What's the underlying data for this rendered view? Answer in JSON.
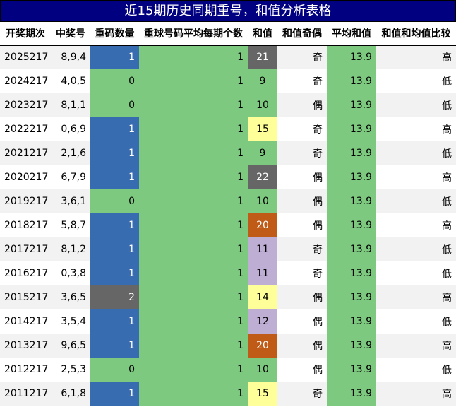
{
  "title": "近15期历史同期重号，和值分析表格",
  "headers": [
    "开奖期次",
    "中奖号",
    "重码数量",
    "重球号码平均每期个数",
    "和值",
    "和值奇偶",
    "平均和值",
    "和值和均值比较"
  ],
  "colors": {
    "title_bg": "#000080",
    "green": "#7dc97f",
    "blue": "#386cb0",
    "dark_gray": "#666666",
    "yellow": "#ffff99",
    "orange": "#bf5b17",
    "lavender": "#beaed4",
    "stripe": "#f2f2f2"
  },
  "rows": [
    {
      "period": "2025217",
      "numbers": "8,9,4",
      "repeat": "1",
      "avg_repeat": "1",
      "sum": "21",
      "parity": "奇",
      "avg_sum": "13.9",
      "compare": "高"
    },
    {
      "period": "2024217",
      "numbers": "4,0,5",
      "repeat": "0",
      "avg_repeat": "1",
      "sum": "9",
      "parity": "奇",
      "avg_sum": "13.9",
      "compare": "低"
    },
    {
      "period": "2023217",
      "numbers": "8,1,1",
      "repeat": "0",
      "avg_repeat": "1",
      "sum": "10",
      "parity": "偶",
      "avg_sum": "13.9",
      "compare": "低"
    },
    {
      "period": "2022217",
      "numbers": "0,6,9",
      "repeat": "1",
      "avg_repeat": "1",
      "sum": "15",
      "parity": "奇",
      "avg_sum": "13.9",
      "compare": "高"
    },
    {
      "period": "2021217",
      "numbers": "2,1,6",
      "repeat": "1",
      "avg_repeat": "1",
      "sum": "9",
      "parity": "奇",
      "avg_sum": "13.9",
      "compare": "低"
    },
    {
      "period": "2020217",
      "numbers": "6,7,9",
      "repeat": "1",
      "avg_repeat": "1",
      "sum": "22",
      "parity": "偶",
      "avg_sum": "13.9",
      "compare": "高"
    },
    {
      "period": "2019217",
      "numbers": "3,6,1",
      "repeat": "0",
      "avg_repeat": "1",
      "sum": "10",
      "parity": "偶",
      "avg_sum": "13.9",
      "compare": "低"
    },
    {
      "period": "2018217",
      "numbers": "5,8,7",
      "repeat": "1",
      "avg_repeat": "1",
      "sum": "20",
      "parity": "偶",
      "avg_sum": "13.9",
      "compare": "高"
    },
    {
      "period": "2017217",
      "numbers": "8,1,2",
      "repeat": "1",
      "avg_repeat": "1",
      "sum": "11",
      "parity": "奇",
      "avg_sum": "13.9",
      "compare": "低"
    },
    {
      "period": "2016217",
      "numbers": "0,3,8",
      "repeat": "1",
      "avg_repeat": "1",
      "sum": "11",
      "parity": "奇",
      "avg_sum": "13.9",
      "compare": "低"
    },
    {
      "period": "2015217",
      "numbers": "3,6,5",
      "repeat": "2",
      "avg_repeat": "1",
      "sum": "14",
      "parity": "偶",
      "avg_sum": "13.9",
      "compare": "高"
    },
    {
      "period": "2014217",
      "numbers": "3,5,4",
      "repeat": "1",
      "avg_repeat": "1",
      "sum": "12",
      "parity": "偶",
      "avg_sum": "13.9",
      "compare": "低"
    },
    {
      "period": "2013217",
      "numbers": "9,6,5",
      "repeat": "1",
      "avg_repeat": "1",
      "sum": "20",
      "parity": "偶",
      "avg_sum": "13.9",
      "compare": "高"
    },
    {
      "period": "2012217",
      "numbers": "2,5,3",
      "repeat": "0",
      "avg_repeat": "1",
      "sum": "10",
      "parity": "偶",
      "avg_sum": "13.9",
      "compare": "低"
    },
    {
      "period": "2011217",
      "numbers": "6,1,8",
      "repeat": "1",
      "avg_repeat": "1",
      "sum": "15",
      "parity": "奇",
      "avg_sum": "13.9",
      "compare": "高"
    }
  ]
}
